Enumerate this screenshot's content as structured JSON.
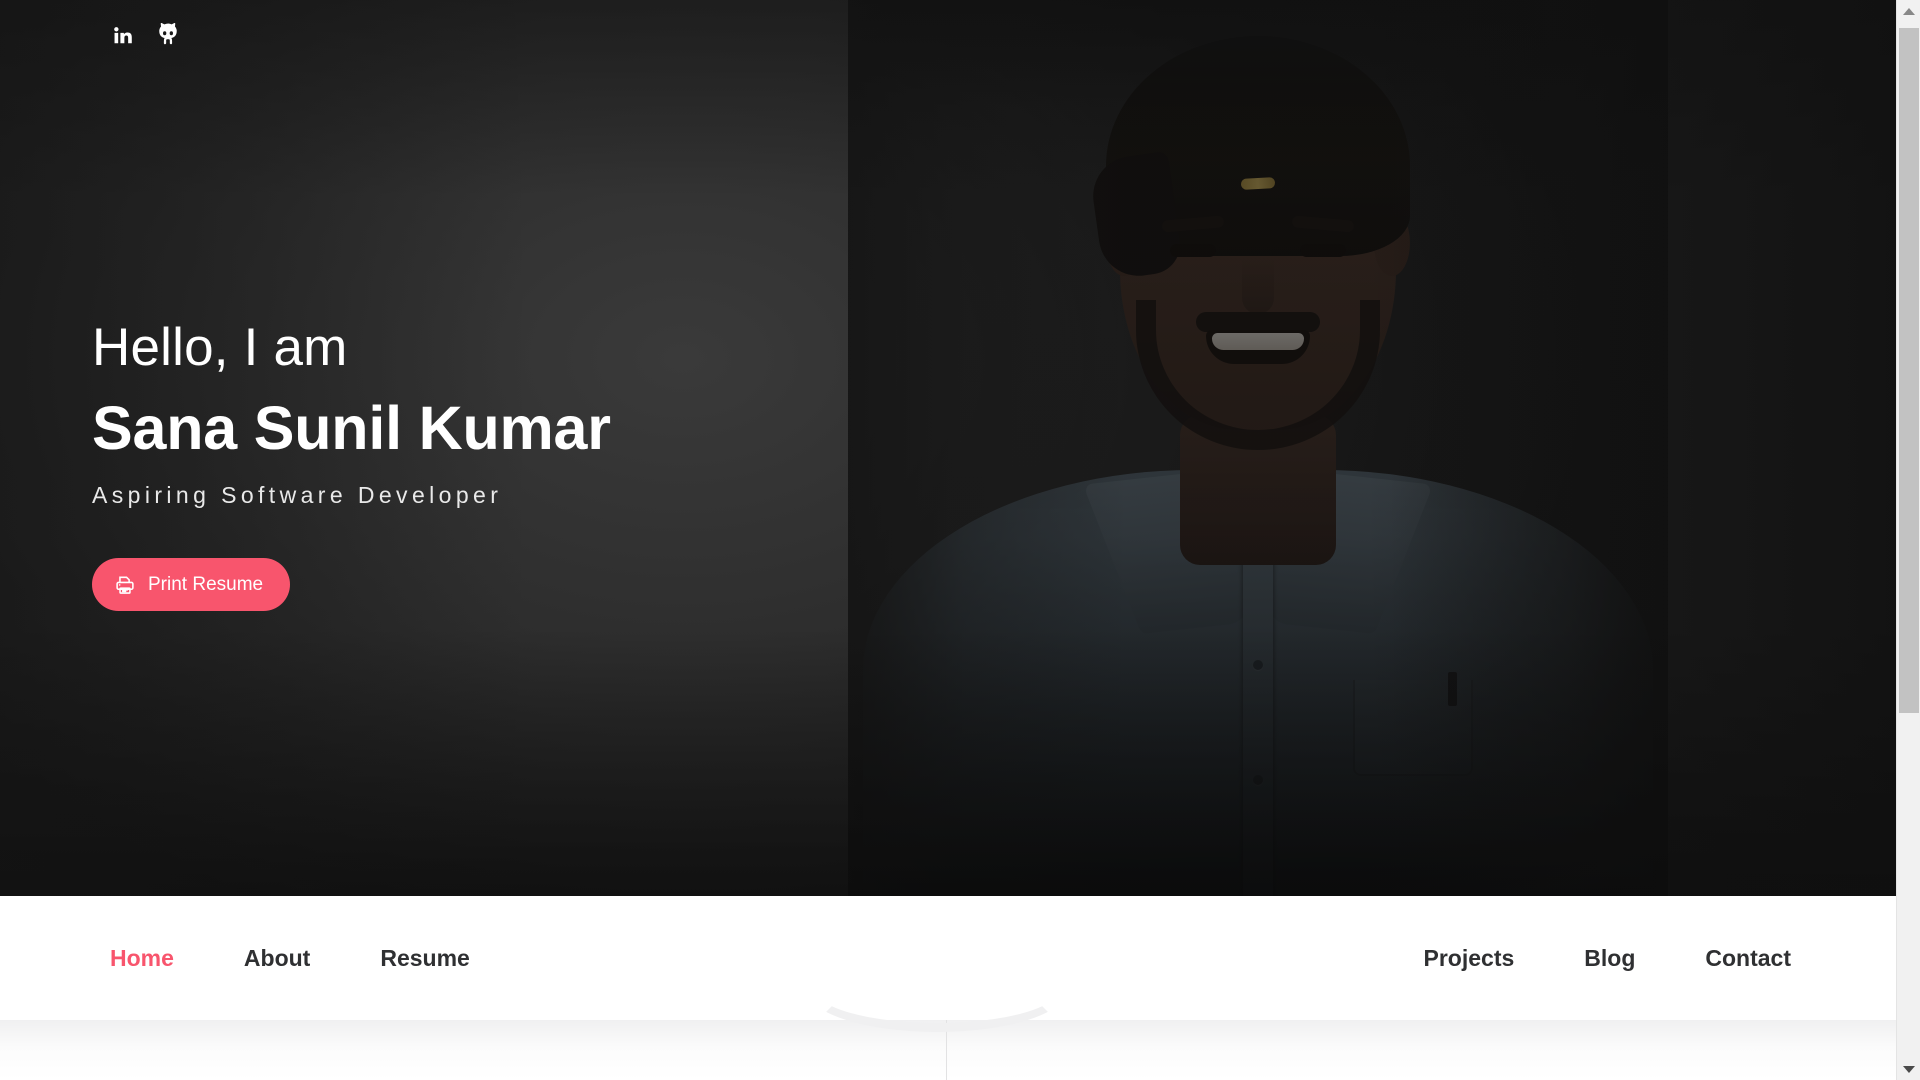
{
  "hero": {
    "greeting": "Hello, I am",
    "name": "Sana Sunil Kumar",
    "tagline": "Aspiring Software Developer",
    "print_button_label": "Print Resume",
    "photo_alt": "Portrait of a smiling man in a blue-grey shirt",
    "socials": [
      {
        "name": "linkedin-icon",
        "label": "LinkedIn"
      },
      {
        "name": "github-icon",
        "label": "GitHub"
      }
    ]
  },
  "nav": {
    "left_items": [
      {
        "label": "Home",
        "active": true
      },
      {
        "label": "About",
        "active": false
      },
      {
        "label": "Resume",
        "active": false
      }
    ],
    "right_items": [
      {
        "label": "Projects",
        "active": false
      },
      {
        "label": "Blog",
        "active": false
      },
      {
        "label": "Contact",
        "active": false
      }
    ]
  },
  "colors": {
    "accent": "#f8556d",
    "nav_text": "#2f3032",
    "hero_background": "#2e2e2e",
    "nav_background": "#ffffff",
    "section_background": "#f0f0f1"
  },
  "scrollbar": {
    "up_arrow": "scroll-up",
    "down_arrow": "scroll-down"
  }
}
